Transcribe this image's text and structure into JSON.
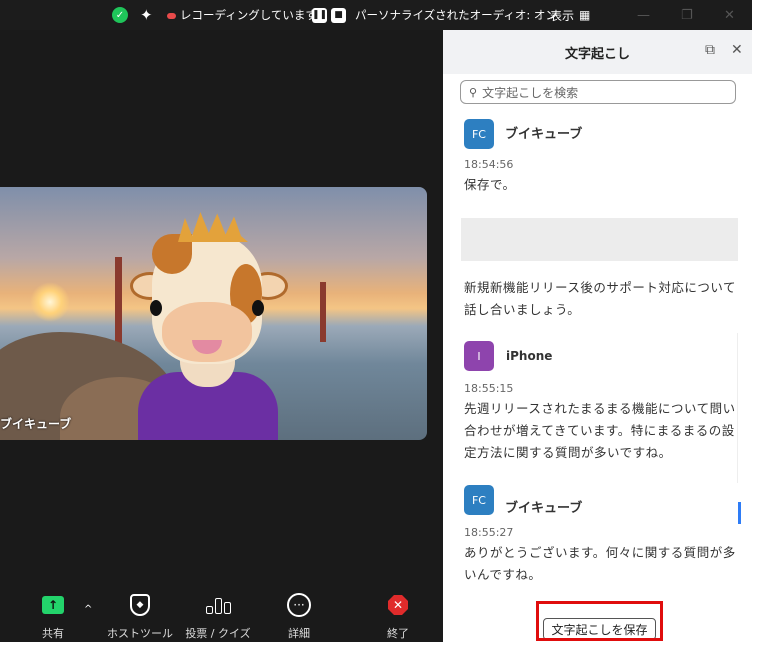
{
  "topbar": {
    "recording_label": "レコーディングしています...",
    "audio_label": "パーソナライズされたオーディオ: オン",
    "view_label": "表示",
    "pause_glyph": "❚❚",
    "stop_glyph": "■"
  },
  "video": {
    "participant_name": "ブイキューブ"
  },
  "toolbar": {
    "share_label": "共有",
    "host_tools_label": "ホストツール",
    "poll_label": "投票 / クイズ",
    "more_label": "詳細",
    "end_label": "終了"
  },
  "transcript": {
    "title": "文字起こし",
    "search_placeholder": "文字起こしを検索",
    "save_label": "文字起こしを保存",
    "messages": [
      {
        "initials": "FC",
        "speaker": "ブイキューブ",
        "time": "18:54:56",
        "text": "保存で。",
        "color": "#2d7fc1"
      },
      {
        "initials": "",
        "speaker": "",
        "time": "",
        "text": "新規新機能リリース後のサポート対応について話し合いましょう。",
        "color": ""
      },
      {
        "initials": "I",
        "speaker": "iPhone",
        "time": "18:55:15",
        "text": "先週リリースされたまるまる機能について問い合わせが増えてきています。特にまるまるの設定方法に関する質問が多いですね。",
        "color": "#8e44ad"
      },
      {
        "initials": "FC",
        "speaker": "ブイキューブ",
        "time": "18:55:27",
        "text": "ありがとうございます。何々に関する質問が多いんですね。",
        "color": "#2d7fc1"
      }
    ]
  },
  "colors": {
    "accent_green": "#23d36b",
    "end_red": "#e02b2b",
    "highlight_red": "#e00d0d"
  }
}
